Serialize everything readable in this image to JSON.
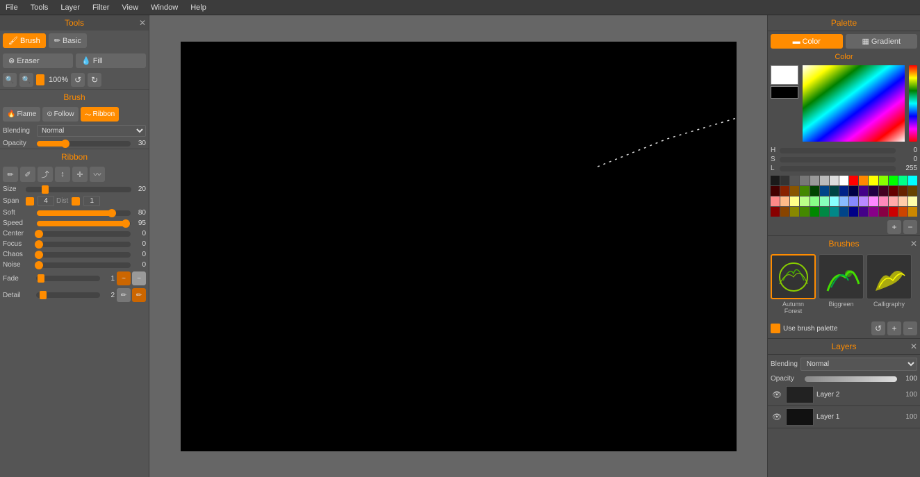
{
  "menubar": {
    "items": [
      "File",
      "Tools",
      "Layer",
      "Filter",
      "View",
      "Window",
      "Help"
    ]
  },
  "tools_panel": {
    "title": "Tools",
    "brush_btn": "Brush",
    "basic_btn": "Basic",
    "eraser_btn": "Eraser",
    "fill_btn": "Fill",
    "zoom_value": "100%"
  },
  "brush_section": {
    "title": "Brush",
    "flame_btn": "Flame",
    "follow_btn": "Follow",
    "ribbon_btn": "Ribbon",
    "blending_label": "Blending",
    "blending_value": "Normal",
    "opacity_label": "Opacity",
    "opacity_value": "30"
  },
  "ribbon_section": {
    "title": "Ribbon",
    "size_label": "Size",
    "size_value": "20",
    "span_label": "Span",
    "span_value": "4",
    "dist_label": "Dist",
    "dist_value": "1",
    "soft_label": "Soft",
    "soft_value": "80",
    "speed_label": "Speed",
    "speed_value": "95",
    "center_label": "Center",
    "center_value": "0",
    "focus_label": "Focus",
    "focus_value": "0",
    "chaos_label": "Chaos",
    "chaos_value": "0",
    "noise_label": "Noise",
    "noise_value": "0",
    "fade_label": "Fade",
    "fade_value": "1",
    "detail_label": "Detail",
    "detail_value": "2"
  },
  "palette": {
    "title": "Palette",
    "color_tab": "Color",
    "gradient_tab": "Gradient",
    "color_section_label": "Color",
    "hsl": {
      "h_label": "H",
      "h_value": "0",
      "s_label": "S",
      "s_value": "0",
      "l_label": "L",
      "l_value": "255"
    },
    "colors_row1": [
      "#1a1a1a",
      "#333",
      "#555",
      "#777",
      "#999",
      "#bbb",
      "#ddd",
      "#fff",
      "#f00",
      "#f80",
      "#ff0",
      "#8f0",
      "#0f0",
      "#0f8",
      "#0ff",
      "#08f",
      "#00f",
      "#80f"
    ],
    "colors_row2": [
      "#400",
      "#820",
      "#850",
      "#480",
      "#040",
      "#048",
      "#044",
      "#028",
      "#004",
      "#408",
      "#204",
      "#402",
      "#600",
      "#620",
      "#640",
      "#260",
      "#060",
      "#064"
    ],
    "colors_row3": [
      "#f88",
      "#fb8",
      "#ff8",
      "#bf8",
      "#8f8",
      "#8fb",
      "#8ff",
      "#8bf",
      "#88f",
      "#b8f",
      "#f8f",
      "#f8b",
      "#faa",
      "#fca",
      "#ffa",
      "#afa",
      "#afa",
      "#afc"
    ],
    "colors_row4": [
      "#800",
      "#840",
      "#880",
      "#480",
      "#080",
      "#084",
      "#088",
      "#048",
      "#008",
      "#408",
      "#808",
      "#804",
      "#c00",
      "#c40",
      "#c80",
      "#4c0",
      "#0c0",
      "#0c4"
    ]
  },
  "brushes": {
    "title": "Brushes",
    "brush_list": [
      {
        "name": "Autumn\nForest",
        "id": "autumn-forest"
      },
      {
        "name": "Biggreen",
        "id": "biggreen"
      },
      {
        "name": "Calligraphy",
        "id": "calligraphy"
      }
    ],
    "use_palette_label": "Use brush palette"
  },
  "layers": {
    "title": "Layers",
    "blending_label": "Blending",
    "blending_value": "Normal",
    "opacity_label": "Opacity",
    "opacity_value": "100",
    "layer_list": [
      {
        "name": "Layer 2",
        "visible": true,
        "opacity": "100"
      },
      {
        "name": "Layer 1",
        "visible": true,
        "opacity": "100"
      }
    ]
  }
}
